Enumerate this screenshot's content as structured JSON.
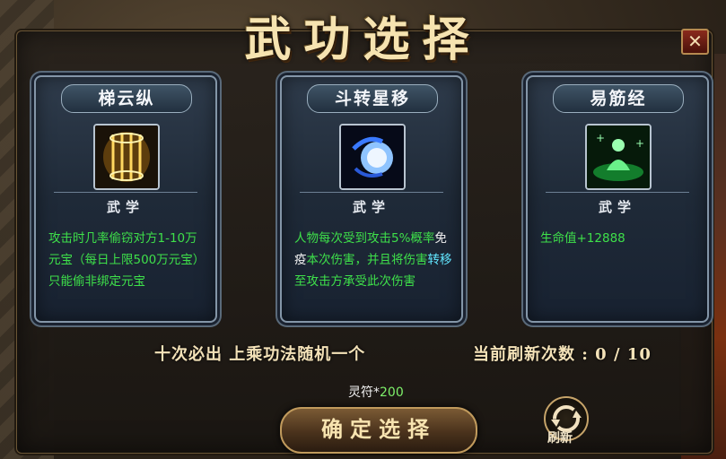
{
  "title": "武功选择",
  "close_label": "✕",
  "cards": [
    {
      "name": "梯云纵",
      "category": "武学",
      "desc": [
        {
          "t": "攻击时几率偷窃对方1-10万元宝（每日上限500万元宝）只能偷非绑定元宝",
          "k": "g"
        }
      ],
      "icon": "golden-cage-icon"
    },
    {
      "name": "斗转星移",
      "category": "武学",
      "desc": [
        {
          "t": "人物每次受到攻击5%概率",
          "k": "g"
        },
        {
          "t": "免疫",
          "k": "w"
        },
        {
          "t": "本次伤害，并且将伤害",
          "k": "g"
        },
        {
          "t": "转移",
          "k": "c"
        },
        {
          "t": "至攻击方承受此次伤害",
          "k": "g"
        }
      ],
      "icon": "blue-orb-icon"
    },
    {
      "name": "易筋经",
      "category": "武学",
      "desc": [
        {
          "t": "生命值+12888",
          "k": "g"
        }
      ],
      "icon": "meditation-icon"
    }
  ],
  "hint_left": "十次必出 上乘功法随机一个",
  "hint_right": "当前刷新次数 : 0 / 10",
  "cost_item": "灵符",
  "cost_sep": "*",
  "cost_value": "200",
  "confirm_label": "确定选择",
  "refresh_label": "刷新",
  "colors": {
    "green": "#3ee04a",
    "cyan": "#62e6ff",
    "gold": "#f6e3b0"
  }
}
